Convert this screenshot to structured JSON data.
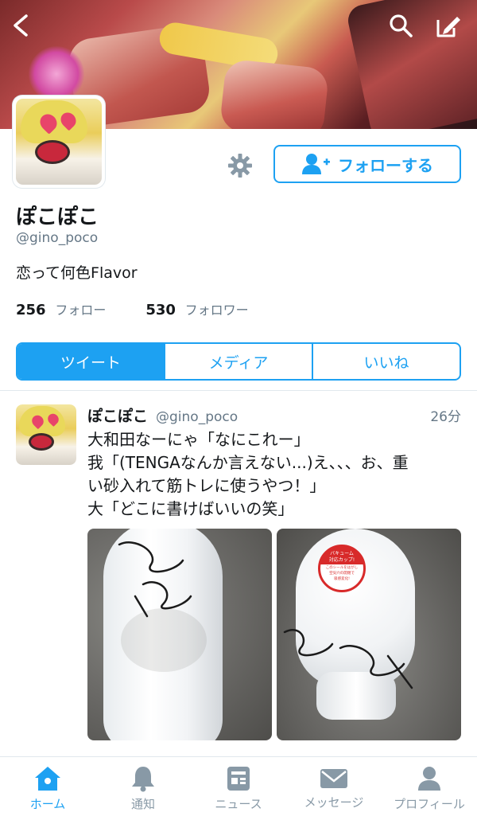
{
  "header": {
    "back_icon": "back-arrow-icon",
    "search_icon": "search-icon",
    "compose_icon": "compose-icon"
  },
  "profile": {
    "name": "ぽこぽこ",
    "handle": "@gino_poco",
    "bio": "恋って何色Flavor",
    "following_count": "256",
    "following_label": "フォロー",
    "followers_count": "530",
    "followers_label": "フォロワー",
    "follow_button": "フォローする"
  },
  "tabs": [
    {
      "label": "ツイート",
      "active": true
    },
    {
      "label": "メディア",
      "active": false
    },
    {
      "label": "いいね",
      "active": false
    }
  ],
  "tweet": {
    "name": "ぽこぽこ",
    "handle": "@gino_poco",
    "time": "26分",
    "lines": [
      "大和田なーにゃ「なにこれー」",
      "我「(TENGAなんか言えない...)え、、、お、重",
      "い砂入れて筋トレに使うやつ！」",
      "大「どこに書けばいいの笑」"
    ],
    "media_sticker": [
      "バキューム",
      "対応カップ!",
      "このシールをはがし",
      "空気穴の開閉で",
      "吸感変化!"
    ]
  },
  "nav": [
    {
      "label": "ホーム",
      "icon": "home-icon",
      "active": true
    },
    {
      "label": "通知",
      "icon": "bell-icon",
      "active": false
    },
    {
      "label": "ニュース",
      "icon": "news-icon",
      "active": false
    },
    {
      "label": "メッセージ",
      "icon": "envelope-icon",
      "active": false
    },
    {
      "label": "プロフィール",
      "icon": "person-icon",
      "active": false
    }
  ],
  "colors": {
    "accent": "#1da1f2",
    "muted": "#657786",
    "nav_inactive": "#8899a6"
  }
}
